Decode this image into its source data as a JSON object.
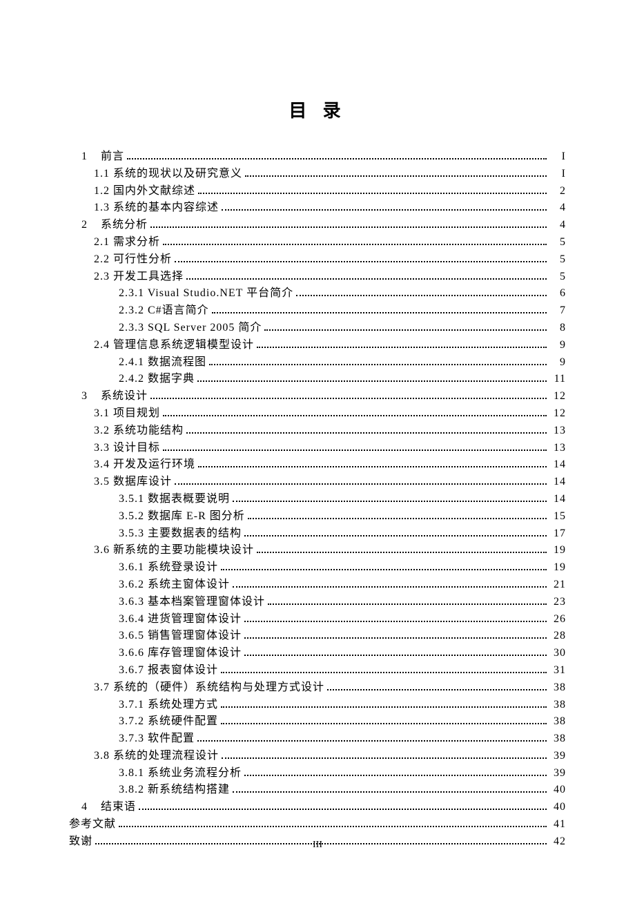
{
  "title": "目 录",
  "footer_page": "III",
  "toc": [
    {
      "indent": 1,
      "num": "1",
      "label": "前言",
      "page": "I",
      "chapnum_class": "chapnum"
    },
    {
      "indent": 2,
      "num": "1.1",
      "label": "系统的现状以及研究意义",
      "page": "I"
    },
    {
      "indent": 2,
      "num": "1.2",
      "label": "国内外文献综述",
      "page": "2"
    },
    {
      "indent": 2,
      "num": "1.3",
      "label": "系统的基本内容综述",
      "page": "4"
    },
    {
      "indent": 1,
      "num": "2",
      "label": "系统分析",
      "page": "4",
      "chapnum_class": "chapnum"
    },
    {
      "indent": 2,
      "num": "2.1",
      "label": "需求分析",
      "page": "5"
    },
    {
      "indent": 2,
      "num": "2.2",
      "label": "可行性分析",
      "page": "5"
    },
    {
      "indent": 2,
      "num": "2.3",
      "label": "开发工具选择",
      "page": "5"
    },
    {
      "indent": 3,
      "num": "2.3.1",
      "label": "Visual Studio.NET 平台简介",
      "page": "6"
    },
    {
      "indent": 3,
      "num": "2.3.2",
      "label": "C#语言简介",
      "page": "7"
    },
    {
      "indent": 3,
      "num": "2.3.3",
      "label": "SQL Server 2005 简介",
      "page": "8"
    },
    {
      "indent": 2,
      "num": "2.4",
      "label": "管理信息系统逻辑模型设计",
      "page": "9"
    },
    {
      "indent": 3,
      "num": "2.4.1",
      "label": "数据流程图",
      "page": "9"
    },
    {
      "indent": 3,
      "num": "2.4.2",
      "label": "数据字典",
      "page": "11"
    },
    {
      "indent": 1,
      "num": "3",
      "label": "系统设计",
      "page": "12",
      "chapnum_class": "chapnum"
    },
    {
      "indent": 2,
      "num": "3.1",
      "label": "项目规划",
      "page": "12"
    },
    {
      "indent": 2,
      "num": "3.2",
      "label": "系统功能结构",
      "page": "13"
    },
    {
      "indent": 2,
      "num": "3.3",
      "label": "设计目标",
      "page": "13"
    },
    {
      "indent": 2,
      "num": "3.4",
      "label": "开发及运行环境",
      "page": "14"
    },
    {
      "indent": 2,
      "num": "3.5",
      "label": "数据库设计",
      "page": "14"
    },
    {
      "indent": 3,
      "num": "3.5.1",
      "label": "数据表概要说明",
      "page": "14"
    },
    {
      "indent": 3,
      "num": "3.5.2",
      "label": "数据库 E-R 图分析",
      "page": "15"
    },
    {
      "indent": 3,
      "num": "3.5.3",
      "label": "主要数据表的结构",
      "page": "17",
      "tight": true
    },
    {
      "indent": 2,
      "num": "3.6",
      "label": "新系统的主要功能模块设计",
      "page": "19"
    },
    {
      "indent": 3,
      "num": "3.6.1",
      "label": "系统登录设计",
      "page": "19"
    },
    {
      "indent": 3,
      "num": "3.6.2",
      "label": "系统主窗体设计",
      "page": "21"
    },
    {
      "indent": 3,
      "num": "3.6.3",
      "label": "基本档案管理窗体设计",
      "page": "23"
    },
    {
      "indent": 3,
      "num": "3.6.4",
      "label": "进货管理窗体设计",
      "page": "26"
    },
    {
      "indent": 3,
      "num": "3.6.5",
      "label": "销售管理窗体设计",
      "page": "28"
    },
    {
      "indent": 3,
      "num": "3.6.6",
      "label": "库存管理窗体设计",
      "page": "30",
      "tight": true
    },
    {
      "indent": 3,
      "num": "3.6.7",
      "label": "报表窗体设计",
      "page": "31",
      "tight": true
    },
    {
      "indent": 2,
      "num": "3.7",
      "label": "系统的（硬件）系统结构与处理方式设计",
      "page": "38",
      "tight": true
    },
    {
      "indent": 3,
      "num": "3.7.1",
      "label": "系统处理方式",
      "page": "38",
      "tight": true
    },
    {
      "indent": 3,
      "num": "3.7.2",
      "label": "系统硬件配置",
      "page": "38",
      "tight": true
    },
    {
      "indent": 3,
      "num": "3.7.3",
      "label": "软件配置",
      "page": "38",
      "tight": true
    },
    {
      "indent": 2,
      "num": "3.8",
      "label": "系统的处理流程设计",
      "page": "39",
      "tight": true
    },
    {
      "indent": 3,
      "num": "3.8.1",
      "label": "系统业务流程分析",
      "page": "39",
      "tight": true
    },
    {
      "indent": 3,
      "num": "3.8.2",
      "label": "新系统结构搭建",
      "page": "40",
      "tight": true
    },
    {
      "indent": 1,
      "num": "4",
      "label": "结束语",
      "page": "40",
      "chapnum_class": "chapnum"
    },
    {
      "indent": 0,
      "num": "",
      "label": "参考文献",
      "page": "41"
    },
    {
      "indent": 0,
      "num": "",
      "label": "致谢",
      "page": "42"
    }
  ]
}
